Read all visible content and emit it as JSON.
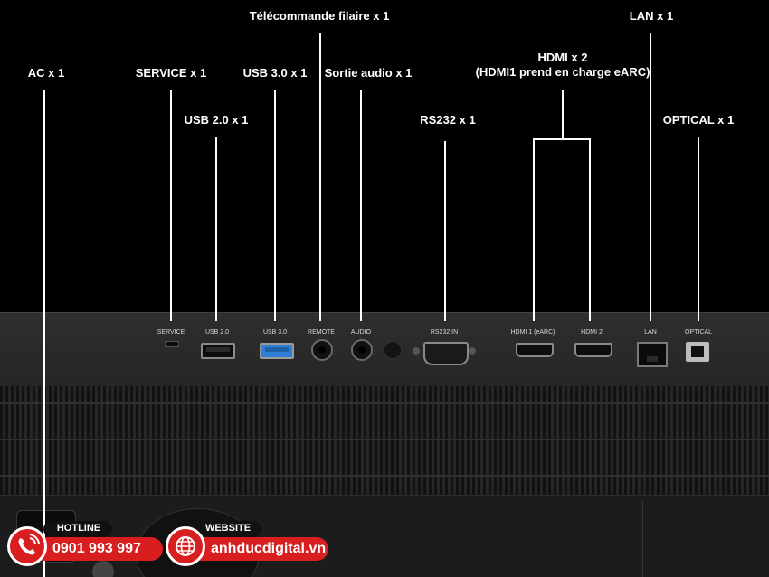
{
  "callouts": {
    "ac": "AC x 1",
    "service": "SERVICE x 1",
    "usb2": "USB 2.0 x 1",
    "usb3": "USB 3.0 x 1",
    "remote": "Télécommande filaire x 1",
    "audio": "Sortie audio x 1",
    "rs232": "RS232 x 1",
    "hdmi_line1": "HDMI x 2",
    "hdmi_line2": "(HDMI1 prend en charge eARC)",
    "lan": "LAN x 1",
    "optical": "OPTICAL x 1"
  },
  "ports": {
    "service": "SERVICE",
    "usb2": "USB 2.0",
    "usb3": "USB 3.0",
    "remote": "REMOTE",
    "audio": "AUDIO",
    "rs232": "RS232  IN",
    "hdmi1": "HDMI 1 (eARC)",
    "hdmi2": "HDMI 2",
    "lan": "LAN",
    "optical": "OPTICAL"
  },
  "contact": {
    "hotline_label": "HOTLINE",
    "hotline_number": "0901 993 997",
    "website_label": "WEBSITE",
    "website_url": "anhducdigital.vn"
  },
  "colors": {
    "background": "#000000",
    "badge_red": "#d81e1e",
    "usb3_blue": "#2f7fd6"
  },
  "icons": [
    "phone-icon",
    "globe-icon"
  ]
}
